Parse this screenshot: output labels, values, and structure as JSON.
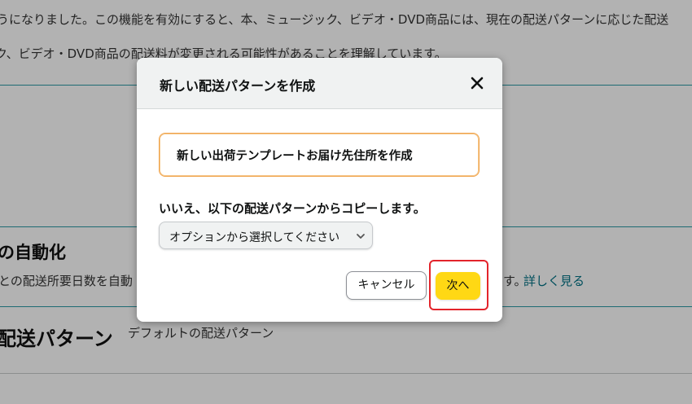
{
  "background": {
    "notice_line1": "うになりました。この機能を有効にすると、本、ミュージック、ビデオ・DVD商品には、現在の配送パターンに応じた配送",
    "notice_line2": "ク、ビデオ・DVD商品の配送料が変更される可能性があることを理解しています。",
    "section_heading": "の自動化",
    "section_desc": "との配送所要日数を自動",
    "section_desc_tail": "す。",
    "learn_more": "詳しく見る",
    "pattern_heading": "配送パターン",
    "pattern_sub": "デフォルトの配送パターン"
  },
  "modal": {
    "title": "新しい配送パターンを作成",
    "close_icon": "close-icon",
    "option_new": "新しい出荷テンプレートお届け先住所を作成",
    "copy_label": "いいえ、以下の配送パターンからコピーします。",
    "select_value": "オプションから選択してください",
    "cancel_label": "キャンセル",
    "next_label": "次へ"
  },
  "colors": {
    "accent_yellow": "#ffd814",
    "selected_border": "#f0a34a",
    "teal_rule": "#2b9aa5",
    "link": "#007185",
    "highlight_red": "#e3242b"
  }
}
